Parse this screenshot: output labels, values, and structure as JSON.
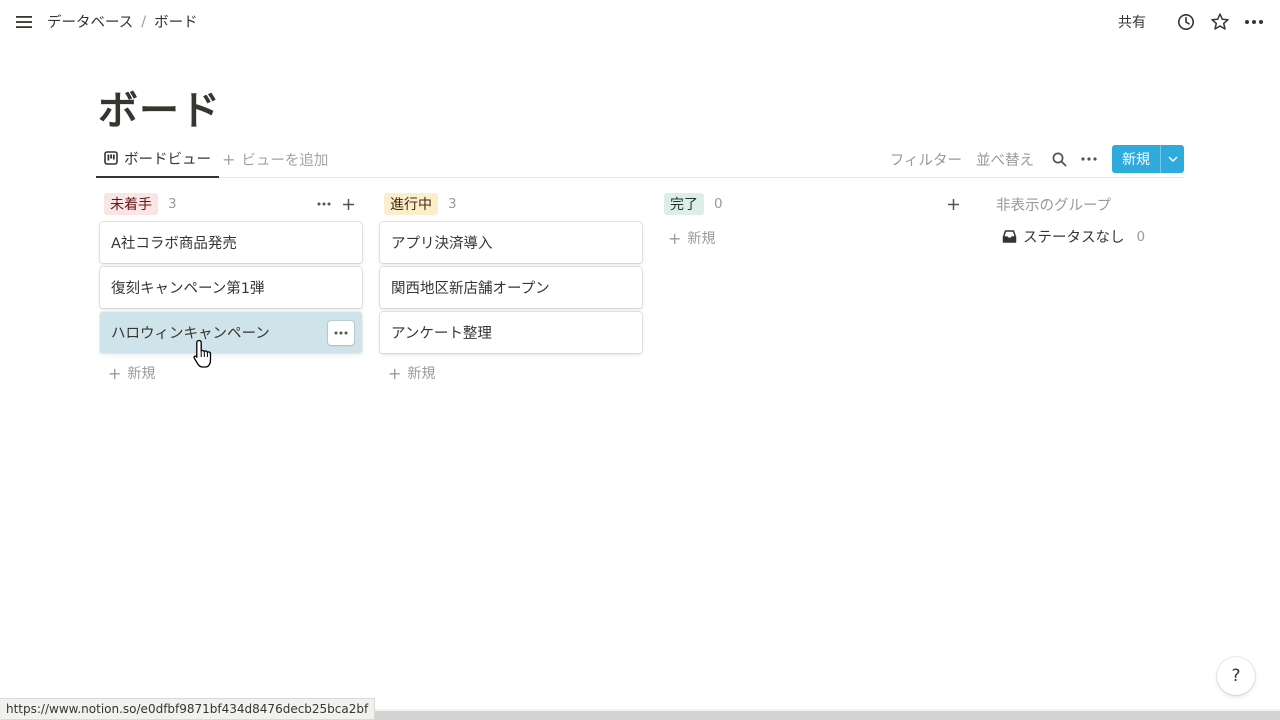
{
  "breadcrumb": {
    "parent": "データベース",
    "separator": "/",
    "current": "ボード"
  },
  "topbar": {
    "share_label": "共有"
  },
  "page": {
    "title": "ボード"
  },
  "viewbar": {
    "active_view": "ボードビュー",
    "add_view": "ビューを追加",
    "filter": "フィルター",
    "sort": "並べ替え",
    "new_label": "新規"
  },
  "columns": [
    {
      "label": "未着手",
      "count": "3",
      "tag_bg": "#fbe4e4",
      "tag_color": "#5d1715",
      "cards": [
        "A社コラボ商品発売",
        "復刻キャンペーン第1弾",
        "ハロウィンキャンペーン"
      ],
      "add_label": "新規"
    },
    {
      "label": "進行中",
      "count": "3",
      "tag_bg": "#fbeecc",
      "tag_color": "#49290e",
      "cards": [
        "アプリ決済導入",
        "関西地区新店舗オープン",
        "アンケート整理"
      ],
      "add_label": "新規"
    },
    {
      "label": "完了",
      "count": "0",
      "tag_bg": "#ddedea",
      "tag_color": "#1c3829",
      "cards": [],
      "add_label": "新規"
    }
  ],
  "hidden_groups": {
    "title": "非表示のグループ",
    "items": [
      {
        "label": "ステータスなし",
        "count": "0"
      }
    ]
  },
  "help_label": "?",
  "status_bar": {
    "url": "https://www.notion.so/e0dfbf9871bf434d8476decb25bca2bf"
  },
  "colors": {
    "accent": "#2eaadc",
    "hover_card": "#cfe3ea",
    "text": "#37352f",
    "muted": "#9b9a97"
  }
}
